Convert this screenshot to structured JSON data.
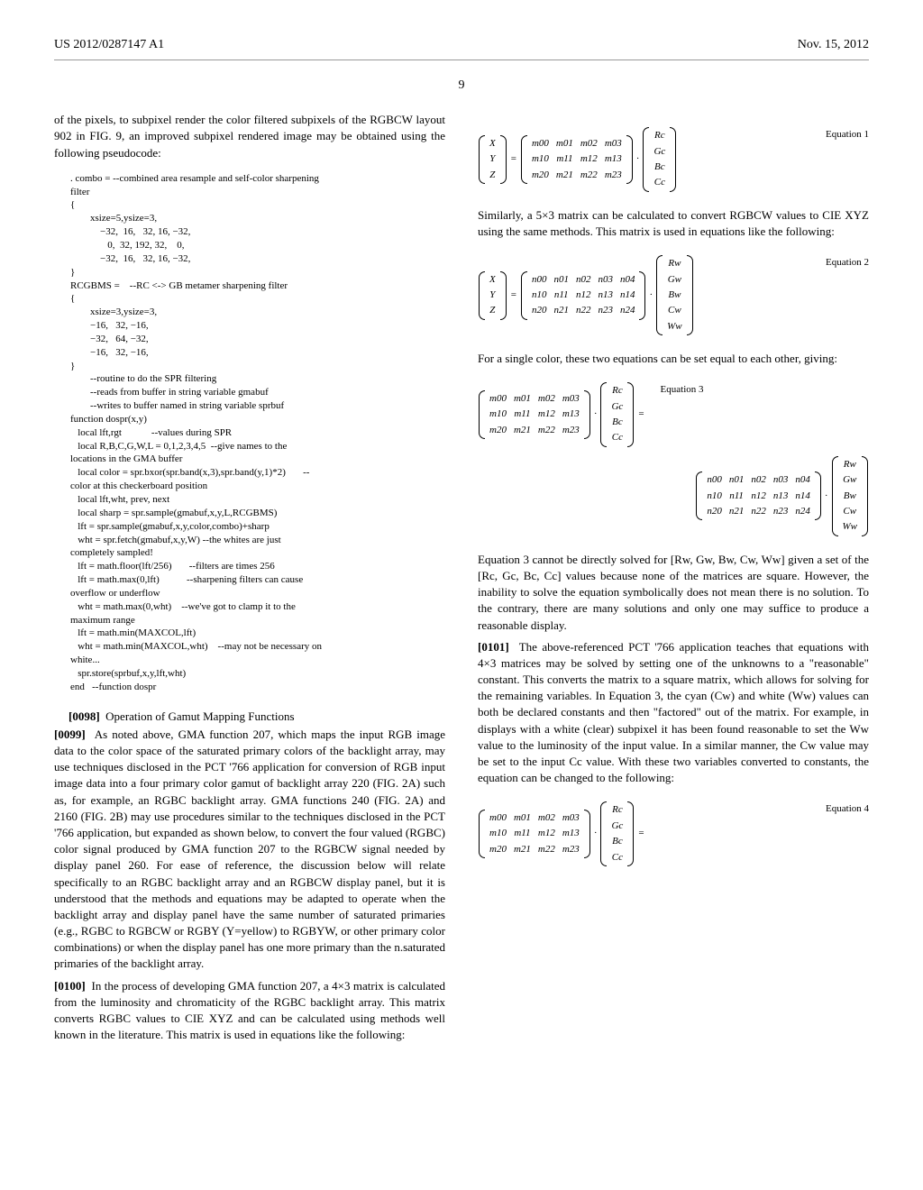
{
  "header": {
    "pub": "US 2012/0287147 A1",
    "date": "Nov. 15, 2012"
  },
  "page_number": "9",
  "left": {
    "intro": "of the pixels, to subpixel render the color filtered subpixels of the RGBCW layout 902 in FIG. 9, an improved subpixel rendered image may be obtained using the following pseudocode:",
    "code": ". combo = --combined area resample and self-color sharpening\nfilter\n{\n        xsize=5,ysize=3,\n            −32,  16,   32, 16, −32,\n               0,  32, 192, 32,    0,\n            −32,  16,   32, 16, −32,\n}\nRCGBMS =    --RC <-> GB metamer sharpening filter\n{\n        xsize=3,ysize=3,\n        −16,   32, −16,\n        −32,   64, −32,\n        −16,   32, −16,\n}\n        --routine to do the SPR filtering\n        --reads from buffer in string variable gmabuf\n        --writes to buffer named in string variable sprbuf\nfunction dospr(x,y)\n   local lft,rgt            --values during SPR\n   local R,B,C,G,W,L = 0,1,2,3,4,5  --give names to the\nlocations in the GMA buffer\n   local color = spr.bxor(spr.band(x,3),spr.band(y,1)*2)       --\ncolor at this checkerboard position\n   local lft,wht, prev, next\n   local sharp = spr.sample(gmabuf,x,y,L,RCGBMS)\n   lft = spr.sample(gmabuf,x,y,color,combo)+sharp\n   wht = spr.fetch(gmabuf,x,y,W) --the whites are just\ncompletely sampled!\n   lft = math.floor(lft/256)       --filters are times 256\n   lft = math.max(0,lft)           --sharpening filters can cause\noverflow or underflow\n   wht = math.max(0,wht)    --we've got to clamp it to the\nmaximum range\n   lft = math.min(MAXCOL,lft)\n   wht = math.min(MAXCOL,wht)    --may not be necessary on\nwhite...\n   spr.store(sprbuf,x,y,lft,wht)\nend   --function dospr",
    "sec_title_label": "[0098]",
    "sec_title": "Operation of Gamut Mapping Functions",
    "p99_label": "[0099]",
    "p99": "As noted above, GMA function 207, which maps the input RGB image data to the color space of the saturated primary colors of the backlight array, may use techniques disclosed in the PCT '766 application for conversion of RGB input image data into a four primary color gamut of backlight array 220 (FIG. 2A) such as, for example, an RGBC backlight array. GMA functions 240 (FIG. 2A) and 2160 (FIG. 2B) may use procedures similar to the techniques disclosed in the PCT '766 application, but expanded as shown below, to convert the four valued (RGBC) color signal produced by GMA function 207 to the RGBCW signal needed by display panel 260. For ease of reference, the discussion below will relate specifically to an RGBC backlight array and an RGBCW display panel, but it is understood that the methods and equations may be adapted to operate when the backlight array and display panel have the same number of saturated primaries (e.g., RGBC to RGBCW or RGBY (Y=yellow) to RGBYW, or other primary color combinations) or when the display panel has one more primary than the n.saturated primaries of the backlight array.",
    "p100_label": "[0100]",
    "p100": "In the process of developing GMA function 207, a 4×3 matrix is calculated from the luminosity and chromaticity of the RGBC backlight array. This matrix converts RGBC values to CIE XYZ and can be calculated using methods well known in the literature. This matrix is used in equations like the following:"
  },
  "right": {
    "eq1_label": "Equation 1",
    "p_r1": "Similarly, a 5×3 matrix can be calculated to convert RGBCW values to CIE XYZ using the same methods. This matrix is used in equations like the following:",
    "eq2_label": "Equation 2",
    "p_r2": "For a single color, these two equations can be set equal to each other, giving:",
    "eq3_label": "Equation 3",
    "p_r3": "Equation 3 cannot be directly solved for [Rw, Gw, Bw, Cw, Ww] given a set of the [Rc, Gc, Bc, Cc] values because none of the matrices are square. However, the inability to solve the equation symbolically does not mean there is no solution. To the contrary, there are many solutions and only one may suffice to produce a reasonable display.",
    "p101_label": "[0101]",
    "p101": "The above-referenced PCT '766 application teaches that equations with 4×3 matrices may be solved by setting one of the unknowns to a \"reasonable\" constant. This converts the matrix to a square matrix, which allows for solving for the remaining variables. In Equation 3, the cyan (Cw) and white (Ww) values can both be declared constants and then \"factored\" out of the matrix. For example, in displays with a white (clear) subpixel it has been found reasonable to set the Ww value to the luminosity of the input value. In a similar manner, the Cw value may be set to the input Cc value. With these two variables converted to constants, the equation can be changed to the following:",
    "eq4_label": "Equation 4"
  },
  "mat": {
    "xyz": [
      "X",
      "Y",
      "Z"
    ],
    "m34": [
      [
        "m00",
        "m01",
        "m02",
        "m03"
      ],
      [
        "m10",
        "m11",
        "m12",
        "m13"
      ],
      [
        "m20",
        "m21",
        "m22",
        "m23"
      ]
    ],
    "rgbc": [
      "Rc",
      "Gc",
      "Bc",
      "Cc"
    ],
    "n35": [
      [
        "n00",
        "n01",
        "n02",
        "n03",
        "n04"
      ],
      [
        "n10",
        "n11",
        "n12",
        "n13",
        "n14"
      ],
      [
        "n20",
        "n21",
        "n22",
        "n23",
        "n24"
      ]
    ],
    "rgbcw": [
      "Rw",
      "Gw",
      "Bw",
      "Cw",
      "Ww"
    ]
  }
}
